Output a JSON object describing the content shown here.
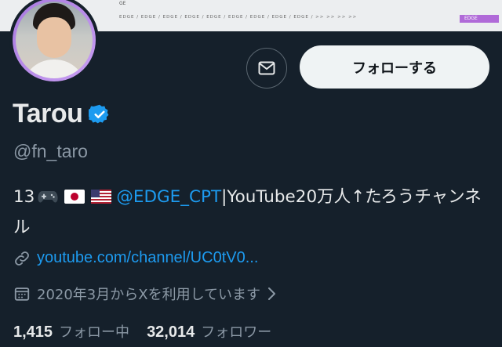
{
  "banner": {
    "corner_text": "GE",
    "edge_row": "EDGE  /  EDGE  /  EDGE  /  EDGE  /  EDGE  /  EDGE  /  EDGE  /  EDGE  /  EDGE  /     >>    >>    >>    >>",
    "tag_label": "EDGE"
  },
  "profile": {
    "display_name": "Tarou",
    "handle": "@fn_taro",
    "bio_prefix": "13",
    "bio_mention": "@EDGE_CPT",
    "bio_suffix": "|YouTube20万人↑たろうチャンネル",
    "website": "youtube.com/channel/UC0tV0...",
    "joined": "2020年3月からXを利用しています"
  },
  "actions": {
    "follow_label": "フォローする"
  },
  "stats": {
    "following_count": "1,415",
    "following_label": "フォロー中",
    "followers_count": "32,014",
    "followers_label": "フォロワー"
  },
  "icons": [
    "mail-icon",
    "verified-badge-icon",
    "game-controller-icon",
    "japan-flag-icon",
    "usa-flag-icon",
    "link-icon",
    "calendar-icon",
    "chevron-right-icon"
  ],
  "colors": {
    "background": "#15202b",
    "link": "#1d9bf0",
    "secondary_text": "#8b98a5",
    "verified": "#1d9bf0",
    "avatar_ring": "#b48ae6"
  }
}
